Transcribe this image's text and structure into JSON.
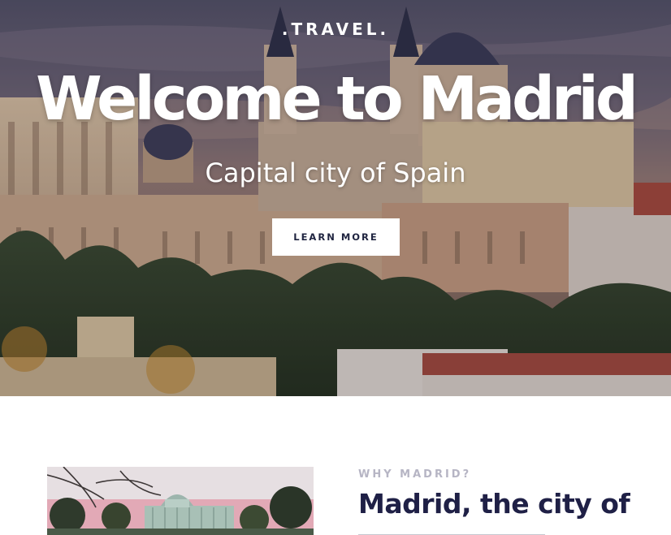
{
  "hero": {
    "kicker": ".TRAVEL.",
    "title": "Welcome to Madrid",
    "subtitle": "Capital city of Spain",
    "cta_label": "LEARN MORE"
  },
  "why": {
    "kicker": "WHY MADRID?",
    "heading": "Madrid, the city of"
  },
  "colors": {
    "heading_navy": "#1f2046",
    "kicker_gray": "#b6b5c4",
    "button_bg": "#ffffff",
    "button_text": "#1f2440"
  }
}
